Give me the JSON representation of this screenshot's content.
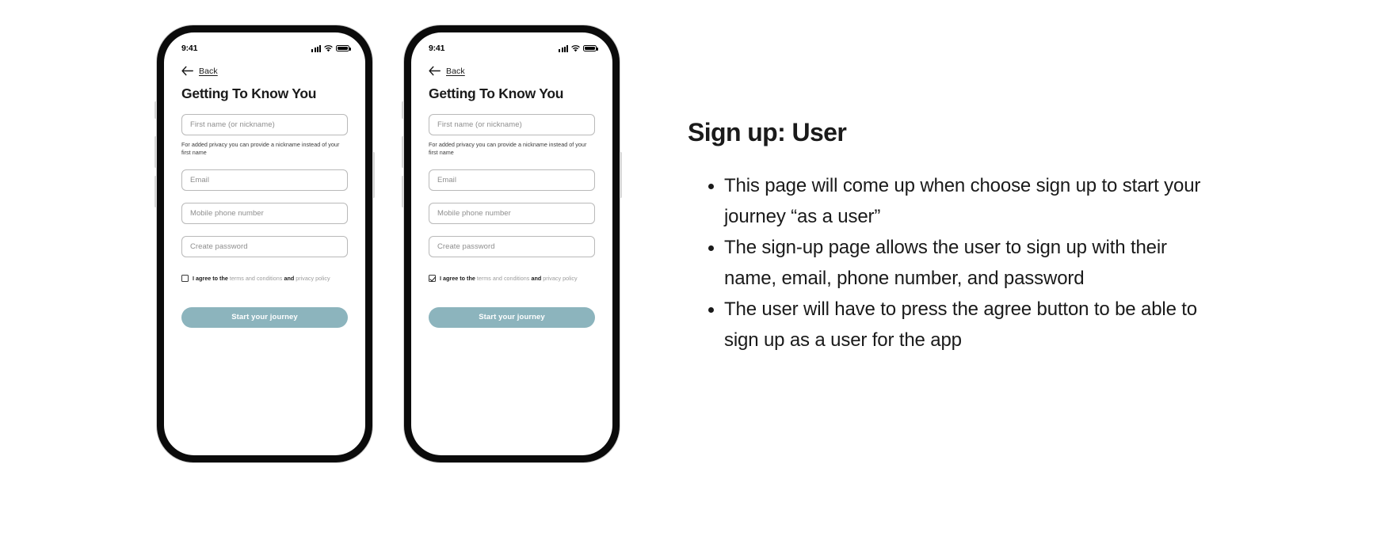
{
  "phones": [
    {
      "name": "phone-unchecked",
      "status": {
        "time": "9:41",
        "signal_icon": "signal-bars-icon",
        "wifi_icon": "wifi-icon",
        "battery_icon": "battery-icon"
      },
      "back": {
        "label": "Back",
        "icon": "arrow-left-icon"
      },
      "title": "Getting To Know You",
      "fields": [
        {
          "name": "first-name",
          "placeholder": "First name (or nickname)",
          "value": ""
        },
        {
          "name": "email",
          "placeholder": "Email",
          "value": ""
        },
        {
          "name": "mobile-phone",
          "placeholder": "Mobile phone number",
          "value": ""
        },
        {
          "name": "create-password",
          "placeholder": "Create password",
          "value": ""
        }
      ],
      "helper_text": "For added privacy you can provide a nickname instead of your first name",
      "agree": {
        "checked": false,
        "lead": "I agree to the",
        "terms_link": "terms and conditions",
        "conjunction": "and",
        "privacy_link": "privacy policy"
      },
      "cta_label": "Start your journey"
    },
    {
      "name": "phone-checked",
      "status": {
        "time": "9:41",
        "signal_icon": "signal-bars-icon",
        "wifi_icon": "wifi-icon",
        "battery_icon": "battery-icon"
      },
      "back": {
        "label": "Back",
        "icon": "arrow-left-icon"
      },
      "title": "Getting To Know You",
      "fields": [
        {
          "name": "first-name",
          "placeholder": "First name (or nickname)",
          "value": ""
        },
        {
          "name": "email",
          "placeholder": "Email",
          "value": ""
        },
        {
          "name": "mobile-phone",
          "placeholder": "Mobile phone number",
          "value": ""
        },
        {
          "name": "create-password",
          "placeholder": "Create password",
          "value": ""
        }
      ],
      "helper_text": "For added privacy you can provide a nickname instead of your first name",
      "agree": {
        "checked": true,
        "lead": "I agree to the",
        "terms_link": "terms and conditions",
        "conjunction": "and",
        "privacy_link": "privacy policy"
      },
      "cta_label": "Start your journey"
    }
  ],
  "notes": {
    "title": "Sign up: User",
    "bullets": [
      "This page will come up when choose sign up to start your journey “as a user”",
      "The sign-up page allows the user to sign up with their name, email, phone number, and password",
      "The user will have to press the agree button to be able to sign up as a user for the app"
    ]
  },
  "colors": {
    "cta_background": "#8cb4bd",
    "cta_text": "#ffffff",
    "link_text": "#9c9c9c",
    "field_border": "#b9b9b9",
    "phone_frame": "#0b0b0b",
    "text_primary": "#1a1a1a"
  }
}
